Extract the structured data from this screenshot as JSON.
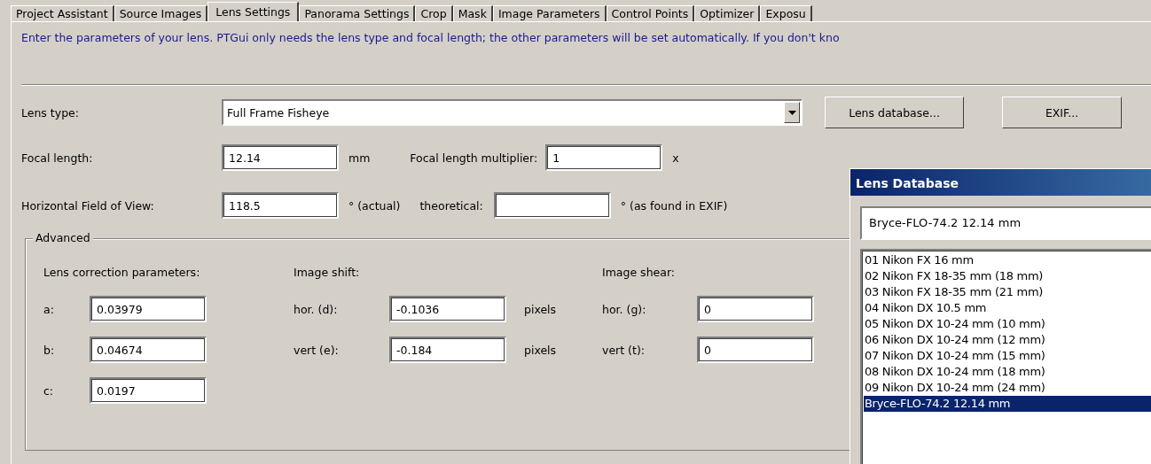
{
  "tabs": [
    {
      "label": "Project Assistant",
      "selected": false
    },
    {
      "label": "Source Images",
      "selected": false
    },
    {
      "label": "Lens Settings",
      "selected": true
    },
    {
      "label": "Panorama Settings",
      "selected": false
    },
    {
      "label": "Crop",
      "selected": false
    },
    {
      "label": "Mask",
      "selected": false
    },
    {
      "label": "Image Parameters",
      "selected": false
    },
    {
      "label": "Control Points",
      "selected": false
    },
    {
      "label": "Optimizer",
      "selected": false
    },
    {
      "label": "Exposu",
      "selected": false
    }
  ],
  "info_text": "Enter the parameters of your lens. PTGui only needs the lens type and focal length; the other parameters will be set automatically. If you don't kno",
  "lens_type": {
    "label": "Lens type:",
    "value": "Full Frame Fisheye"
  },
  "buttons": [
    "Lens database...",
    "EXIF..."
  ],
  "focal_length": {
    "label": "Focal length:",
    "value": "12.14",
    "unit": "mm"
  },
  "multiplier": {
    "label": "Focal length multiplier:",
    "value": "1",
    "unit": "x"
  },
  "hfov": {
    "label": "Horizontal Field of View:",
    "value": "118.5",
    "unit": "° (actual)"
  },
  "theoretical": {
    "label": "theoretical:",
    "unit": "° (as found in EXIF)"
  },
  "advanced": {
    "title": "Advanced",
    "columns": [
      {
        "heading": "Lens correction parameters:",
        "rows": [
          {
            "label": "a:",
            "value": "0.03979"
          },
          {
            "label": "b:",
            "value": "0.04674"
          },
          {
            "label": "c:",
            "value": "0.0197"
          }
        ]
      },
      {
        "heading": "Image shift:",
        "rows": [
          {
            "label": "hor. (d):",
            "value": "-0.1036",
            "unit": "pixels"
          },
          {
            "label": "vert (e):",
            "value": "-0.184",
            "unit": "pixels"
          }
        ]
      },
      {
        "heading": "Image shear:",
        "rows": [
          {
            "label": "hor. (g):",
            "value": "0"
          },
          {
            "label": "vert (t):",
            "value": "0"
          }
        ]
      }
    ]
  },
  "lens_database": {
    "title": "Lens Database",
    "value": "Bryce-FLO-74.2 12.14 mm",
    "items": [
      {
        "label": "01 Nikon FX 16 mm",
        "selected": false
      },
      {
        "label": "02 Nikon FX 18-35 mm (18 mm)",
        "selected": false
      },
      {
        "label": "03 Nikon FX 18-35 mm (21 mm)",
        "selected": false
      },
      {
        "label": "04 Nikon DX 10.5 mm",
        "selected": false
      },
      {
        "label": "05 Nikon DX 10-24 mm (10 mm)",
        "selected": false
      },
      {
        "label": "06 Nikon DX 10-24 mm (12 mm)",
        "selected": false
      },
      {
        "label": "07 Nikon DX 10-24 mm (15 mm)",
        "selected": false
      },
      {
        "label": "08 Nikon DX 10-24 mm (18 mm)",
        "selected": false
      },
      {
        "label": "09 Nikon DX 10-24 mm (24 mm)",
        "selected": false
      },
      {
        "label": "Bryce-FLO-74.2 12.14 mm",
        "selected": true
      }
    ]
  }
}
